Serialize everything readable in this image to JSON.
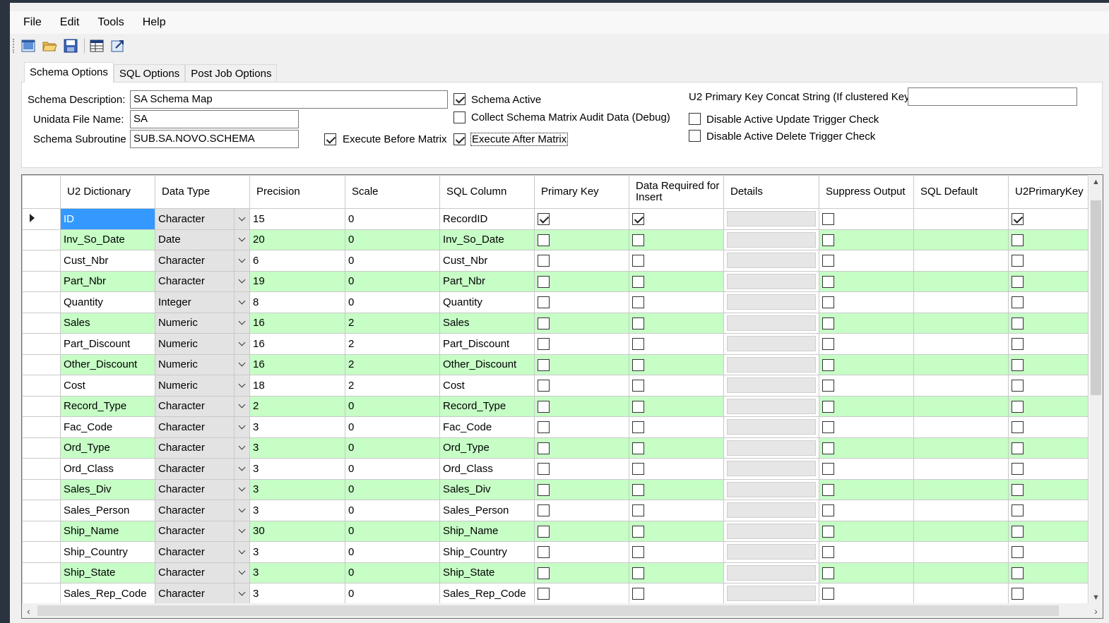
{
  "menu": [
    "File",
    "Edit",
    "Tools",
    "Help"
  ],
  "toolbar": {
    "icons": [
      "new-icon",
      "open-folder-icon",
      "save-icon",
      "import-icon",
      "export-icon"
    ]
  },
  "tabs": [
    "Schema Options",
    "SQL Options",
    "Post Job Options"
  ],
  "form": {
    "schema_description_label": "Schema Description:",
    "schema_description_value": "SA Schema Map",
    "unidata_file_label": "Unidata File Name:",
    "unidata_file_value": "SA",
    "schema_subroutine_label": "Schema Subroutine",
    "schema_subroutine_value": "SUB.SA.NOVO.SCHEMA",
    "execute_before_matrix": "Execute Before Matrix",
    "schema_active": "Schema Active",
    "collect_audit": "Collect Schema Matrix Audit Data (Debug)",
    "execute_after_matrix": "Execute After Matrix",
    "u2_concat_label": "U2 Primary Key Concat String (If clustered Key)",
    "u2_concat_value": "",
    "disable_update_trigger": "Disable Active Update Trigger Check",
    "disable_delete_trigger": "Disable Active Delete Trigger Check",
    "checked": {
      "execute_before_matrix": true,
      "schema_active": true,
      "collect_audit": false,
      "execute_after_matrix": true,
      "disable_update_trigger": false,
      "disable_delete_trigger": false
    }
  },
  "grid": {
    "headers": [
      "U2 Dictionary",
      "Data Type",
      "Precision",
      "Scale",
      "SQL Column",
      "Primary Key",
      "Data Required for Insert",
      "Details",
      "Suppress Output",
      "SQL Default",
      "U2PrimaryKey"
    ],
    "rows": [
      {
        "u2": "ID",
        "type": "Character",
        "precision": "15",
        "scale": "0",
        "sql": "RecordID",
        "pk": true,
        "req": true,
        "suppress": false,
        "u2pk": true
      },
      {
        "u2": "Inv_So_Date",
        "type": "Date",
        "precision": "20",
        "scale": "0",
        "sql": "Inv_So_Date",
        "pk": false,
        "req": false,
        "suppress": false,
        "u2pk": false
      },
      {
        "u2": "Cust_Nbr",
        "type": "Character",
        "precision": "6",
        "scale": "0",
        "sql": "Cust_Nbr",
        "pk": false,
        "req": false,
        "suppress": false,
        "u2pk": false
      },
      {
        "u2": "Part_Nbr",
        "type": "Character",
        "precision": "19",
        "scale": "0",
        "sql": "Part_Nbr",
        "pk": false,
        "req": false,
        "suppress": false,
        "u2pk": false
      },
      {
        "u2": "Quantity",
        "type": "Integer",
        "precision": "8",
        "scale": "0",
        "sql": "Quantity",
        "pk": false,
        "req": false,
        "suppress": false,
        "u2pk": false
      },
      {
        "u2": "Sales",
        "type": "Numeric",
        "precision": "16",
        "scale": "2",
        "sql": "Sales",
        "pk": false,
        "req": false,
        "suppress": false,
        "u2pk": false
      },
      {
        "u2": "Part_Discount",
        "type": "Numeric",
        "precision": "16",
        "scale": "2",
        "sql": "Part_Discount",
        "pk": false,
        "req": false,
        "suppress": false,
        "u2pk": false
      },
      {
        "u2": "Other_Discount",
        "type": "Numeric",
        "precision": "16",
        "scale": "2",
        "sql": "Other_Discount",
        "pk": false,
        "req": false,
        "suppress": false,
        "u2pk": false
      },
      {
        "u2": "Cost",
        "type": "Numeric",
        "precision": "18",
        "scale": "2",
        "sql": "Cost",
        "pk": false,
        "req": false,
        "suppress": false,
        "u2pk": false
      },
      {
        "u2": "Record_Type",
        "type": "Character",
        "precision": "2",
        "scale": "0",
        "sql": "Record_Type",
        "pk": false,
        "req": false,
        "suppress": false,
        "u2pk": false
      },
      {
        "u2": "Fac_Code",
        "type": "Character",
        "precision": "3",
        "scale": "0",
        "sql": "Fac_Code",
        "pk": false,
        "req": false,
        "suppress": false,
        "u2pk": false
      },
      {
        "u2": "Ord_Type",
        "type": "Character",
        "precision": "3",
        "scale": "0",
        "sql": "Ord_Type",
        "pk": false,
        "req": false,
        "suppress": false,
        "u2pk": false
      },
      {
        "u2": "Ord_Class",
        "type": "Character",
        "precision": "3",
        "scale": "0",
        "sql": "Ord_Class",
        "pk": false,
        "req": false,
        "suppress": false,
        "u2pk": false
      },
      {
        "u2": "Sales_Div",
        "type": "Character",
        "precision": "3",
        "scale": "0",
        "sql": "Sales_Div",
        "pk": false,
        "req": false,
        "suppress": false,
        "u2pk": false
      },
      {
        "u2": "Sales_Person",
        "type": "Character",
        "precision": "3",
        "scale": "0",
        "sql": "Sales_Person",
        "pk": false,
        "req": false,
        "suppress": false,
        "u2pk": false
      },
      {
        "u2": "Ship_Name",
        "type": "Character",
        "precision": "30",
        "scale": "0",
        "sql": "Ship_Name",
        "pk": false,
        "req": false,
        "suppress": false,
        "u2pk": false
      },
      {
        "u2": "Ship_Country",
        "type": "Character",
        "precision": "3",
        "scale": "0",
        "sql": "Ship_Country",
        "pk": false,
        "req": false,
        "suppress": false,
        "u2pk": false
      },
      {
        "u2": "Ship_State",
        "type": "Character",
        "precision": "3",
        "scale": "0",
        "sql": "Ship_State",
        "pk": false,
        "req": false,
        "suppress": false,
        "u2pk": false
      },
      {
        "u2": "Sales_Rep_Code",
        "type": "Character",
        "precision": "3",
        "scale": "0",
        "sql": "Sales_Rep_Code",
        "pk": false,
        "req": false,
        "suppress": false,
        "u2pk": false
      }
    ]
  },
  "colors": {
    "alt_row": "#c6fec6",
    "selected_cell": "#3399ff",
    "frame": "#2b3340"
  }
}
